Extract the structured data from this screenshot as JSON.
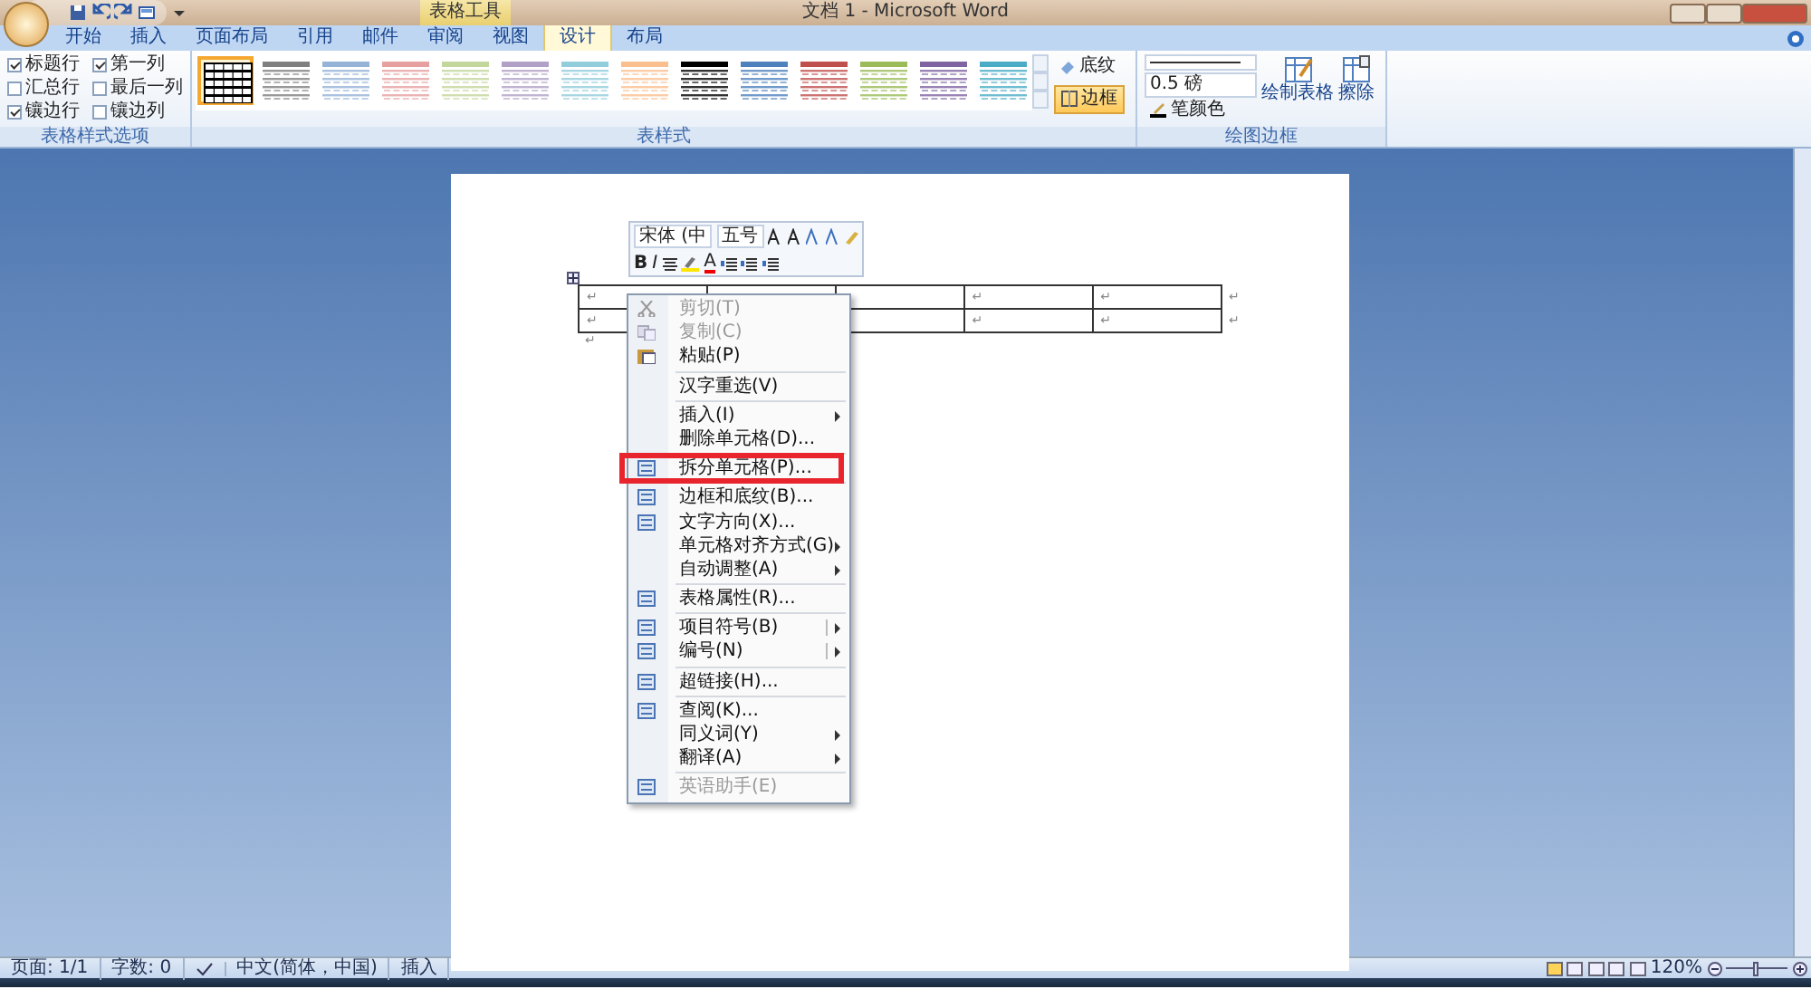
{
  "window": {
    "title": "文档 1 - Microsoft Word",
    "context_tab": "表格工具"
  },
  "tabs": [
    {
      "label": "开始",
      "selected": false
    },
    {
      "label": "插入",
      "selected": false
    },
    {
      "label": "页面布局",
      "selected": false
    },
    {
      "label": "引用",
      "selected": false
    },
    {
      "label": "邮件",
      "selected": false
    },
    {
      "label": "审阅",
      "selected": false
    },
    {
      "label": "视图",
      "selected": false
    },
    {
      "label": "设计",
      "selected": true
    },
    {
      "label": "布局",
      "selected": false
    }
  ],
  "style_options": {
    "label": "表格样式选项",
    "items": [
      {
        "label": "标题行",
        "checked": true
      },
      {
        "label": "第一列",
        "checked": true
      },
      {
        "label": "汇总行",
        "checked": false
      },
      {
        "label": "最后一列",
        "checked": false
      },
      {
        "label": "镶边行",
        "checked": true
      },
      {
        "label": "镶边列",
        "checked": false
      }
    ]
  },
  "table_styles": {
    "label": "表样式",
    "gallery": [
      {
        "kind": "grid",
        "color": "#000000",
        "selected": true
      },
      {
        "kind": "banded",
        "color": "#7f7f7f",
        "selected": false
      },
      {
        "kind": "banded",
        "color": "#95b3d7",
        "selected": false
      },
      {
        "kind": "banded",
        "color": "#e6a0a0",
        "selected": false
      },
      {
        "kind": "banded",
        "color": "#c3d69b",
        "selected": false
      },
      {
        "kind": "banded",
        "color": "#b2a1c7",
        "selected": false
      },
      {
        "kind": "banded",
        "color": "#92cddc",
        "selected": false
      },
      {
        "kind": "banded",
        "color": "#fabf8f",
        "selected": false
      },
      {
        "kind": "banded",
        "color": "#000000",
        "selected": false
      },
      {
        "kind": "banded",
        "color": "#4f81bd",
        "selected": false
      },
      {
        "kind": "banded",
        "color": "#c0504d",
        "selected": false
      },
      {
        "kind": "banded",
        "color": "#9bbb59",
        "selected": false
      },
      {
        "kind": "banded",
        "color": "#8064a2",
        "selected": false
      },
      {
        "kind": "banded",
        "color": "#4bacc6",
        "selected": false
      }
    ],
    "buttons": [
      {
        "label": "底纹",
        "selected": false
      },
      {
        "label": "边框",
        "selected": true
      }
    ]
  },
  "draw_borders": {
    "label": "绘图边框",
    "weight": "0.5 磅",
    "pen_color": "笔颜色",
    "buttons": [
      "绘制表格",
      "擦除"
    ]
  },
  "mini_toolbar": {
    "font": "宋体 (中",
    "size": "五号",
    "bold": "B",
    "italic": "I",
    "font_color": "A"
  },
  "table": {
    "rows": [
      {
        "cells": [
          "↵",
          null,
          null,
          "↵",
          "↵"
        ],
        "end": "↵"
      },
      {
        "cells": [
          "↵",
          null,
          null,
          "↵",
          "↵"
        ],
        "end": "↵"
      }
    ],
    "after": "↵"
  },
  "context_menu": [
    {
      "kind": "item",
      "label": "剪切(T)",
      "disabled": true,
      "icon": true
    },
    {
      "kind": "item",
      "label": "复制(C)",
      "disabled": true,
      "icon": true
    },
    {
      "kind": "item",
      "label": "粘贴(P)",
      "disabled": false,
      "icon": true
    },
    {
      "kind": "separator"
    },
    {
      "kind": "item",
      "label": "汉字重选(V)",
      "disabled": false
    },
    {
      "kind": "separator"
    },
    {
      "kind": "item",
      "label": "插入(I)",
      "disabled": false,
      "submenu": true
    },
    {
      "kind": "item",
      "label": "删除单元格(D)...",
      "disabled": false
    },
    {
      "kind": "separator"
    },
    {
      "kind": "item",
      "label": "拆分单元格(P)...",
      "disabled": false,
      "icon": true,
      "highlighted": true
    },
    {
      "kind": "separator"
    },
    {
      "kind": "item",
      "label": "边框和底纹(B)...",
      "disabled": false,
      "icon": true
    },
    {
      "kind": "item",
      "label": "文字方向(X)...",
      "disabled": false,
      "icon": true
    },
    {
      "kind": "item",
      "label": "单元格对齐方式(G)",
      "disabled": false,
      "submenu": true
    },
    {
      "kind": "item",
      "label": "自动调整(A)",
      "disabled": false,
      "submenu": true
    },
    {
      "kind": "separator"
    },
    {
      "kind": "item",
      "label": "表格属性(R)...",
      "disabled": false,
      "icon": true
    },
    {
      "kind": "separator"
    },
    {
      "kind": "item",
      "label": "项目符号(B)",
      "disabled": false,
      "icon": true,
      "submenu": true,
      "split": true
    },
    {
      "kind": "item",
      "label": "编号(N)",
      "disabled": false,
      "icon": true,
      "submenu": true,
      "split": true
    },
    {
      "kind": "separator"
    },
    {
      "kind": "item",
      "label": "超链接(H)...",
      "disabled": false,
      "icon": true
    },
    {
      "kind": "separator"
    },
    {
      "kind": "item",
      "label": "查阅(K)...",
      "disabled": false,
      "icon": true
    },
    {
      "kind": "item",
      "label": "同义词(Y)",
      "disabled": false,
      "submenu": true
    },
    {
      "kind": "item",
      "label": "翻译(A)",
      "disabled": false,
      "submenu": true
    },
    {
      "kind": "separator"
    },
    {
      "kind": "item",
      "label": "英语助手(E)",
      "disabled": true,
      "icon": true
    }
  ],
  "status_bar": {
    "items": [
      "页面: 1/1",
      "字数: 0",
      "中文(简体，中国)",
      "插入"
    ],
    "zoom": "120%",
    "zoom_slider": {
      "level": 0.5
    }
  }
}
